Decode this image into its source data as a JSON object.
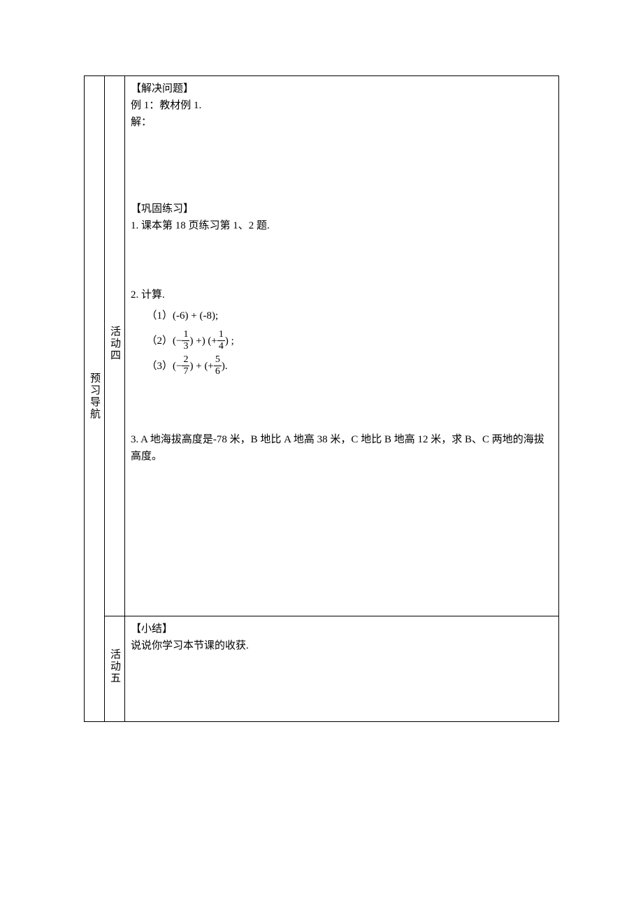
{
  "sidebar": {
    "main_label": "预习导航"
  },
  "activity4": {
    "label": "活动四",
    "section1_title": "【解决问题】",
    "example_line": "例 1：教材例 1.",
    "solution_label": "解：",
    "section2_title": "【巩固练习】",
    "practice1": "1. 课本第 18 页练习第 1、2 题.",
    "calc_title": "2. 计算.",
    "calc_items": [
      {
        "prefix": "（1）",
        "body_plain": "(-6) + (-8);"
      },
      {
        "prefix": "（2）",
        "lead": "(−",
        "f1n": "1",
        "f1d": "3",
        "mid": ") +) (+",
        "f2n": "1",
        "f2d": "4",
        "tail": ") ;"
      },
      {
        "prefix": "（3）",
        "lead": "(−",
        "f1n": "2",
        "f1d": "7",
        "mid": ") + (+",
        "f2n": "5",
        "f2d": "6",
        "tail": ")."
      }
    ],
    "practice3": "3. A 地海拔高度是-78 米，B 地比 A 地高 38 米，C 地比 B 地高 12 米，求 B、C 两地的海拔高度。"
  },
  "activity5": {
    "label": "活动五",
    "section_title": "【小结】",
    "body": "说说你学习本节课的收获."
  }
}
